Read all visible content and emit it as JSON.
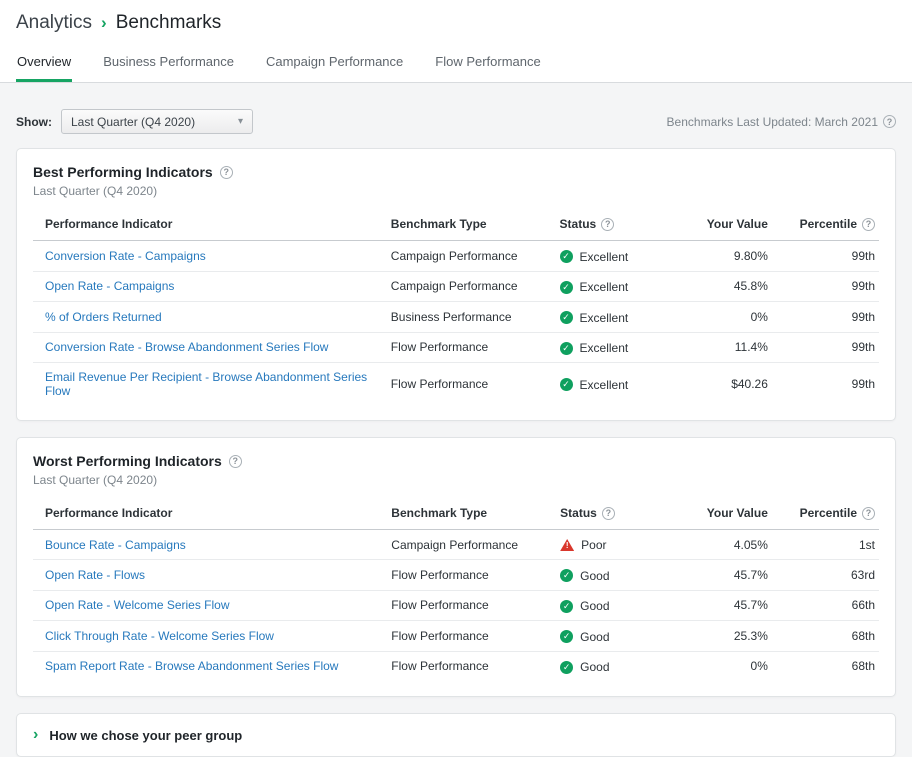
{
  "colors": {
    "accent_green": "#16a463",
    "link_blue": "#2779bd",
    "status_red": "#d9372c",
    "status_green": "#0fa05f"
  },
  "icons": {
    "chevron_right": "›",
    "caret_down": "▾",
    "help": "?",
    "check": "✓",
    "warning": "!"
  },
  "breadcrumb": {
    "parent": "Analytics",
    "current": "Benchmarks"
  },
  "tabs": [
    {
      "label": "Overview"
    },
    {
      "label": "Business Performance"
    },
    {
      "label": "Campaign Performance"
    },
    {
      "label": "Flow Performance"
    }
  ],
  "toolbar": {
    "show_label": "Show:",
    "period_value": "Last Quarter (Q4 2020)",
    "last_updated": "Benchmarks Last Updated: March 2021"
  },
  "table_headers": {
    "indicator": "Performance Indicator",
    "type": "Benchmark Type",
    "status": "Status",
    "value": "Your Value",
    "percentile": "Percentile"
  },
  "best": {
    "title": "Best Performing Indicators",
    "subtitle": "Last Quarter (Q4 2020)",
    "rows": [
      {
        "indicator": "Conversion Rate - Campaigns",
        "type": "Campaign Performance",
        "status": "Excellent",
        "kind": "good",
        "value": "9.80%",
        "percentile": "99th"
      },
      {
        "indicator": "Open Rate - Campaigns",
        "type": "Campaign Performance",
        "status": "Excellent",
        "kind": "good",
        "value": "45.8%",
        "percentile": "99th"
      },
      {
        "indicator": "% of Orders Returned",
        "type": "Business Performance",
        "status": "Excellent",
        "kind": "good",
        "value": "0%",
        "percentile": "99th"
      },
      {
        "indicator": "Conversion Rate - Browse Abandonment Series Flow",
        "type": "Flow Performance",
        "status": "Excellent",
        "kind": "good",
        "value": "11.4%",
        "percentile": "99th"
      },
      {
        "indicator": "Email Revenue Per Recipient - Browse Abandonment Series Flow",
        "type": "Flow Performance",
        "status": "Excellent",
        "kind": "good",
        "value": "$40.26",
        "percentile": "99th"
      }
    ]
  },
  "worst": {
    "title": "Worst Performing Indicators",
    "subtitle": "Last Quarter (Q4 2020)",
    "rows": [
      {
        "indicator": "Bounce Rate - Campaigns",
        "type": "Campaign Performance",
        "status": "Poor",
        "kind": "poor",
        "value": "4.05%",
        "percentile": "1st"
      },
      {
        "indicator": "Open Rate - Flows",
        "type": "Flow Performance",
        "status": "Good",
        "kind": "good",
        "value": "45.7%",
        "percentile": "63rd"
      },
      {
        "indicator": "Open Rate - Welcome Series Flow",
        "type": "Flow Performance",
        "status": "Good",
        "kind": "good",
        "value": "45.7%",
        "percentile": "66th"
      },
      {
        "indicator": "Click Through Rate - Welcome Series Flow",
        "type": "Flow Performance",
        "status": "Good",
        "kind": "good",
        "value": "25.3%",
        "percentile": "68th"
      },
      {
        "indicator": "Spam Report Rate - Browse Abandonment Series Flow",
        "type": "Flow Performance",
        "status": "Good",
        "kind": "good",
        "value": "0%",
        "percentile": "68th"
      }
    ]
  },
  "peer_group": {
    "label": "How we chose your peer group"
  }
}
